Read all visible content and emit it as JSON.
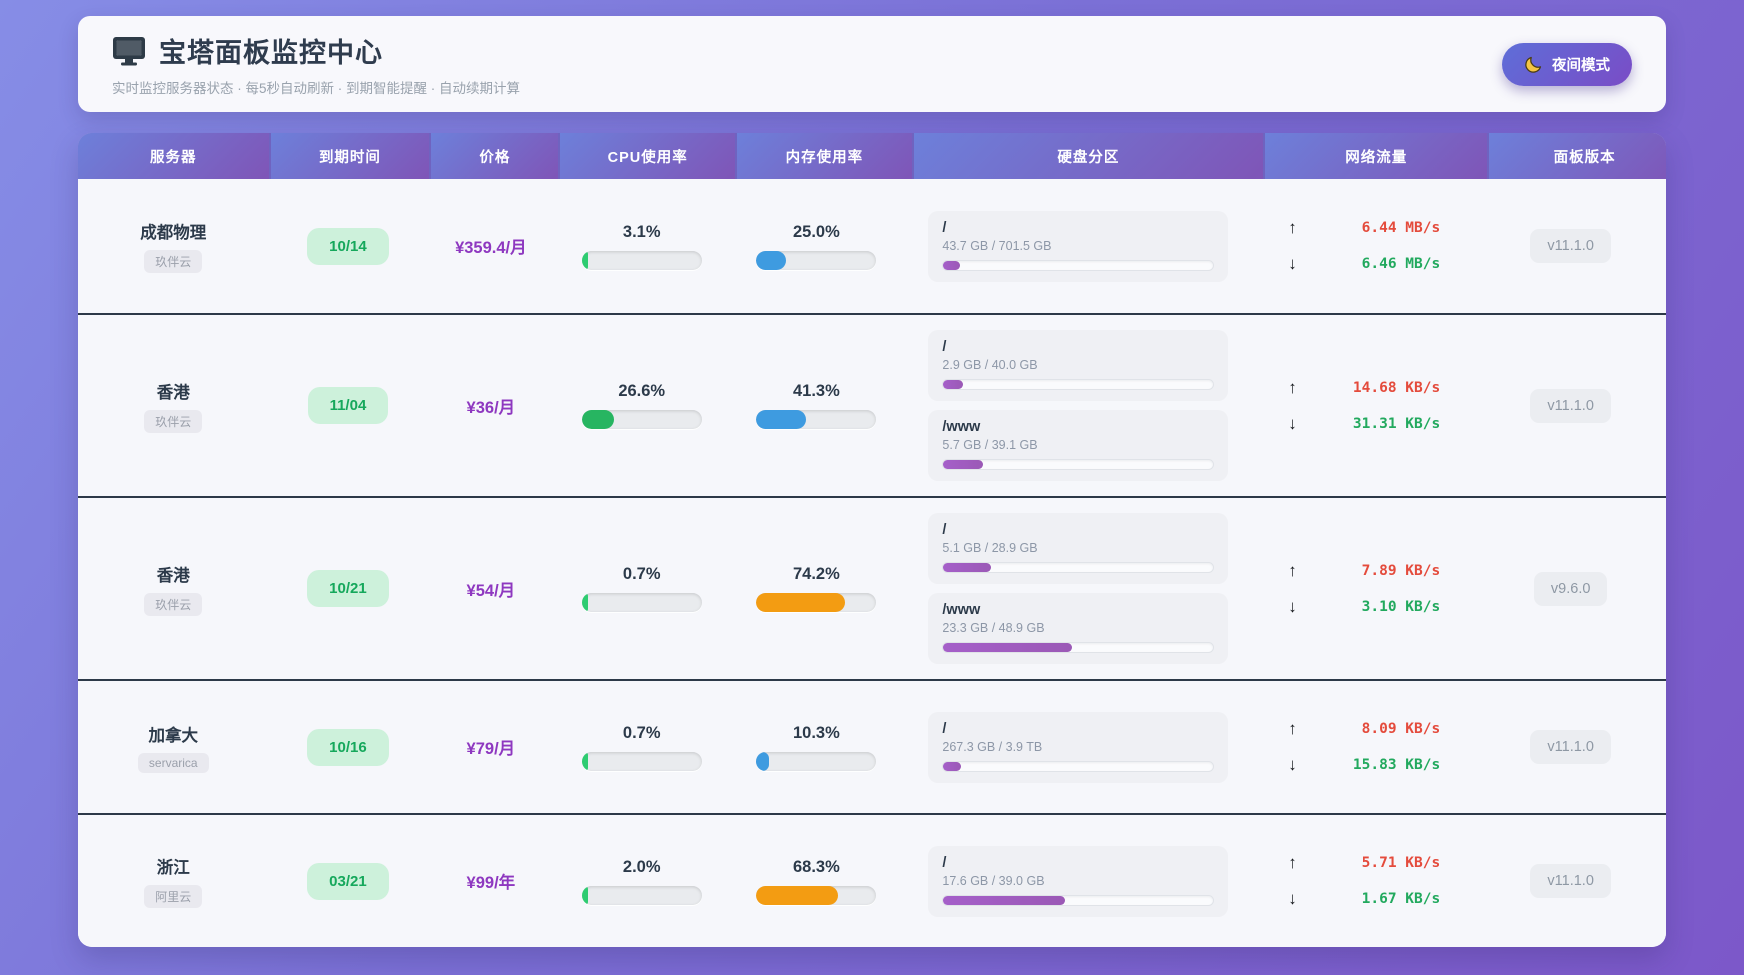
{
  "app": {
    "title": "宝塔面板监控中心",
    "subtitle": "实时监控服务器状态 · 每5秒自动刷新 · 到期智能提醒 · 自动续期计算",
    "night_mode_label": "夜间模式"
  },
  "icons": {
    "title_icon": "monitor-icon",
    "night_mode_icon": "moon-icon",
    "up_arrow": "↑",
    "down_arrow": "↓"
  },
  "colors": {
    "expiry_badge_bg": "#cdf1db",
    "expiry_badge_text": "#16a85c",
    "price_text": "#8e38c0",
    "disk_bar_fill": "#9b59b6",
    "net_up": "#e44b3c",
    "net_down": "#22a95e",
    "header_gradient": [
      "#6d80da",
      "#7f55b7"
    ]
  },
  "table": {
    "headers": [
      "服务器",
      "到期时间",
      "价格",
      "CPU使用率",
      "内存使用率",
      "硬盘分区",
      "网络流量",
      "面板版本"
    ],
    "rows": [
      {
        "server": "成都物理",
        "provider": "玖伴云",
        "expiry": "10/14",
        "price": "¥359.4/月",
        "cpu": {
          "label": "3.1%",
          "percent": 3.1,
          "color": "#2ecc71"
        },
        "memory": {
          "label": "25.0%",
          "percent": 25.0,
          "color": "#3e9be0"
        },
        "disks": [
          {
            "mount": "/",
            "usage": "43.7 GB / 701.5 GB",
            "percent": 6.2
          }
        ],
        "net": {
          "up": "6.44 MB/s",
          "down": "6.46 MB/s"
        },
        "version": "v11.1.0"
      },
      {
        "server": "香港",
        "provider": "玖伴云",
        "expiry": "11/04",
        "price": "¥36/月",
        "cpu": {
          "label": "26.6%",
          "percent": 26.6,
          "color": "#27b561"
        },
        "memory": {
          "label": "41.3%",
          "percent": 41.3,
          "color": "#3e9be0"
        },
        "disks": [
          {
            "mount": "/",
            "usage": "2.9 GB / 40.0 GB",
            "percent": 7.3
          },
          {
            "mount": "/www",
            "usage": "5.7 GB / 39.1 GB",
            "percent": 14.6
          }
        ],
        "net": {
          "up": "14.68 KB/s",
          "down": "31.31 KB/s"
        },
        "version": "v11.1.0"
      },
      {
        "server": "香港",
        "provider": "玖伴云",
        "expiry": "10/21",
        "price": "¥54/月",
        "cpu": {
          "label": "0.7%",
          "percent": 0.7,
          "color": "#2ecc71"
        },
        "memory": {
          "label": "74.2%",
          "percent": 74.2,
          "color": "#f39c12"
        },
        "disks": [
          {
            "mount": "/",
            "usage": "5.1 GB / 28.9 GB",
            "percent": 17.6
          },
          {
            "mount": "/www",
            "usage": "23.3 GB / 48.9 GB",
            "percent": 47.6
          }
        ],
        "net": {
          "up": "7.89 KB/s",
          "down": "3.10 KB/s"
        },
        "version": "v9.6.0"
      },
      {
        "server": "加拿大",
        "provider": "servarica",
        "expiry": "10/16",
        "price": "¥79/月",
        "cpu": {
          "label": "0.7%",
          "percent": 0.7,
          "color": "#2ecc71"
        },
        "memory": {
          "label": "10.3%",
          "percent": 10.3,
          "color": "#3e9be0"
        },
        "disks": [
          {
            "mount": "/",
            "usage": "267.3 GB / 3.9 TB",
            "percent": 6.7
          }
        ],
        "net": {
          "up": "8.09 KB/s",
          "down": "15.83 KB/s"
        },
        "version": "v11.1.0"
      },
      {
        "server": "浙江",
        "provider": "阿里云",
        "expiry": "03/21",
        "price": "¥99/年",
        "cpu": {
          "label": "2.0%",
          "percent": 2.0,
          "color": "#2ecc71"
        },
        "memory": {
          "label": "68.3%",
          "percent": 68.3,
          "color": "#f39c12"
        },
        "disks": [
          {
            "mount": "/",
            "usage": "17.6 GB / 39.0 GB",
            "percent": 45.1
          }
        ],
        "net": {
          "up": "5.71 KB/s",
          "down": "1.67 KB/s"
        },
        "version": "v11.1.0"
      }
    ]
  }
}
